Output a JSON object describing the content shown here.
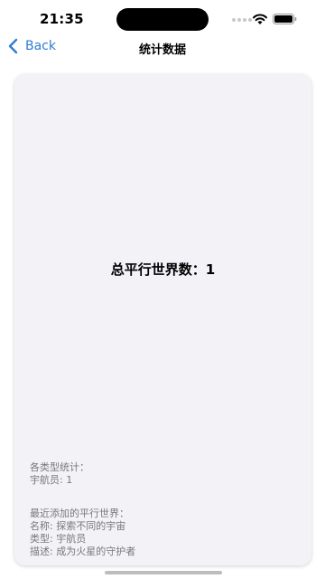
{
  "status_bar": {
    "time": "21:35"
  },
  "nav": {
    "back_label": "Back",
    "title": "统计数据"
  },
  "card": {
    "total_label": "总平行世界数：1",
    "stats": {
      "heading": "各类型统计：",
      "items": [
        "宇航员: 1"
      ]
    },
    "recent": {
      "heading": "最近添加的平行世界：",
      "name": "名称: 探索不同的宇宙",
      "type": "类型: 宇航员",
      "description": "描述: 成为火星的守护者"
    }
  },
  "colors": {
    "accent": "#2f7dd1",
    "card_background": "#f2f2f7",
    "secondary_text": "#7a7a7a"
  },
  "icons": [
    "chevron-left-icon",
    "wifi-icon",
    "battery-icon",
    "signal-icon"
  ]
}
